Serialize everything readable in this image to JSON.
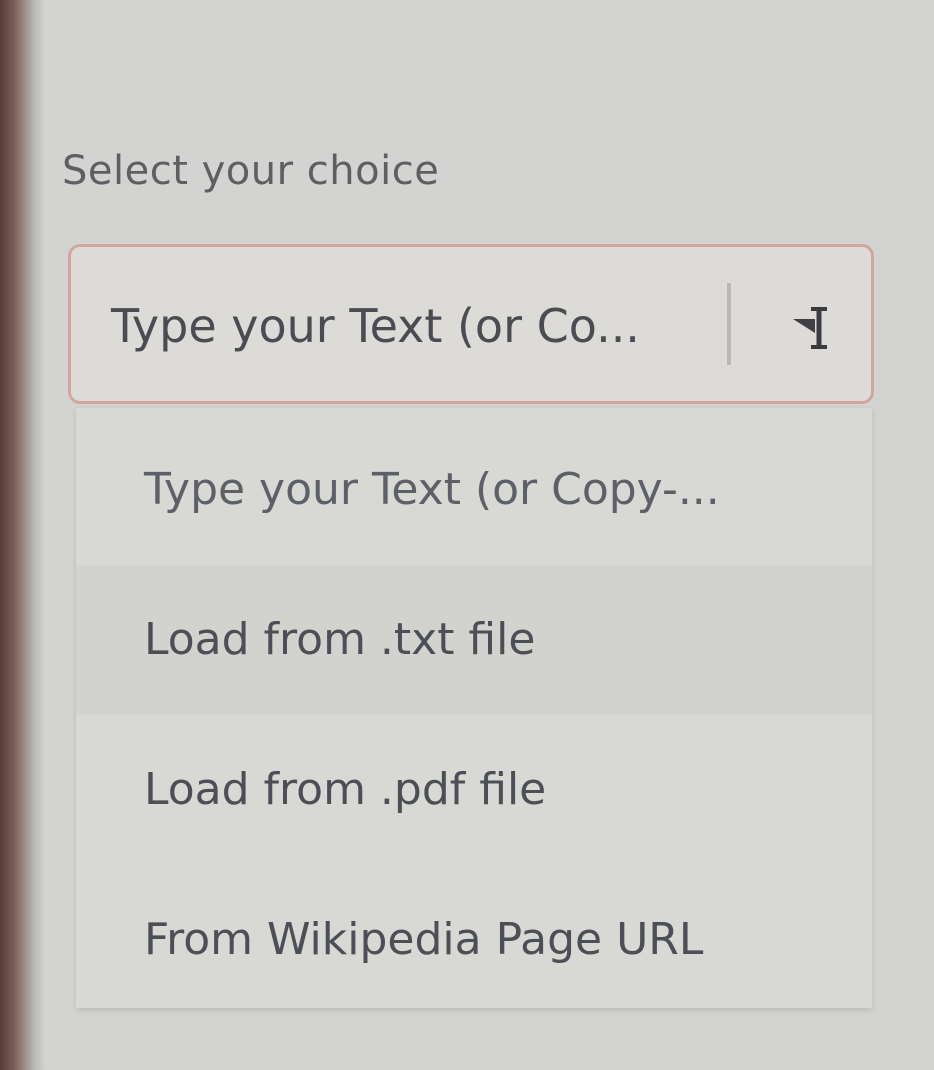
{
  "label": "Select your choice",
  "select": {
    "value": "Type your Text (or Co...",
    "arrow_icon": "dropdown-arrow-icon",
    "accent_color": "#d3a59f"
  },
  "options": [
    "Type your Text (or Copy-...",
    "Load from .txt file",
    "Load from .pdf file",
    "From Wikipedia Page URL"
  ]
}
